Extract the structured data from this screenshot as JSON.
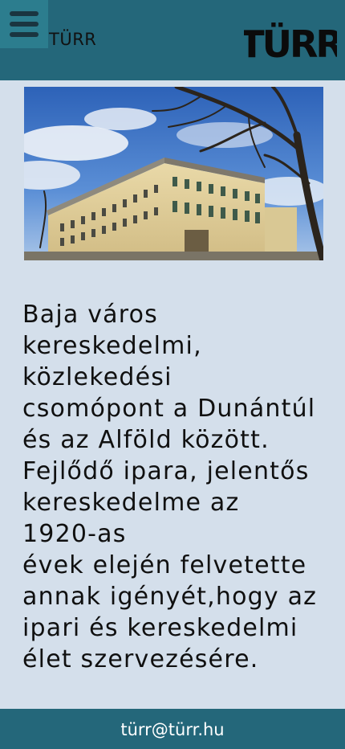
{
  "header": {
    "brand": "TÜRR",
    "logo_text": "TÜRR",
    "menu_icon": "hamburger-menu-icon",
    "background": "#24677a"
  },
  "main": {
    "intro_lines": [
      "Baja város",
      "kereskedelmi,",
      "közlekedési",
      "csomópont a Dunántúl",
      "és az Alföld között.",
      "Fejlődő ipara, jelentős",
      "kereskedelme az",
      "1920-as",
      "évek elején felvetette",
      "annak igényét,hogy az",
      "ipari és kereskedelmi",
      "élet szervezésére."
    ]
  },
  "footer": {
    "email": "türr@türr.hu"
  },
  "colors": {
    "page_background": "#d4dfeb",
    "bar_color": "#24677a",
    "menu_button": "#2c7d8e"
  }
}
